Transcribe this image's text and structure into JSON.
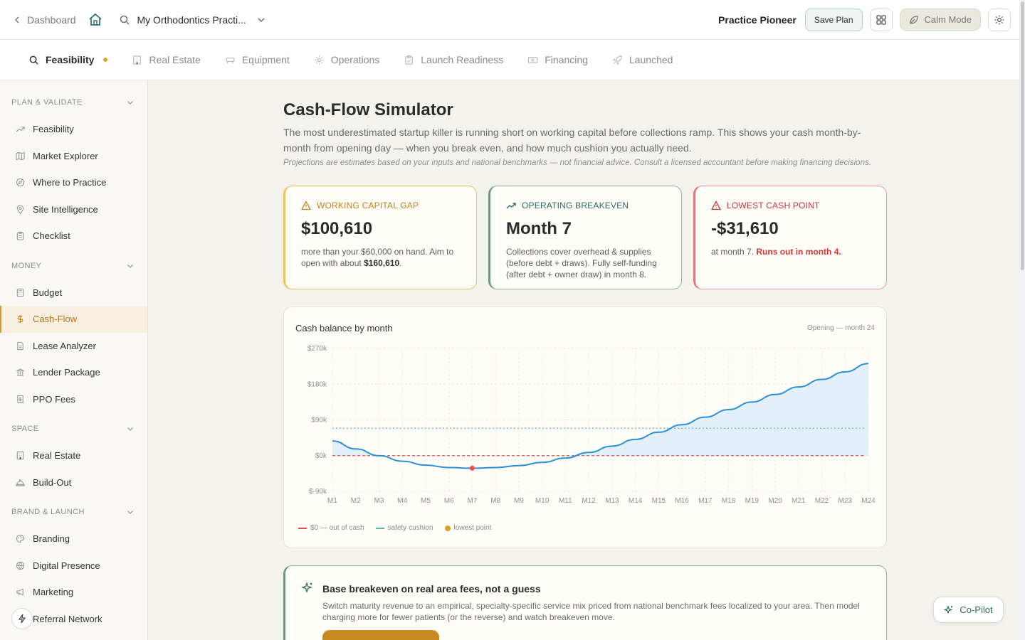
{
  "topbar": {
    "back_label": "Dashboard",
    "practice_name": "My Orthodontics Practi...",
    "brand": "Practice Pioneer",
    "save_label": "Save Plan",
    "calm_label": "Calm Mode"
  },
  "tabs": [
    {
      "label": "Feasibility",
      "icon": "search-icon",
      "active": true
    },
    {
      "label": "Real Estate",
      "icon": "building-icon"
    },
    {
      "label": "Equipment",
      "icon": "chair-icon"
    },
    {
      "label": "Operations",
      "icon": "gear-icon"
    },
    {
      "label": "Launch Readiness",
      "icon": "clipboard-icon"
    },
    {
      "label": "Financing",
      "icon": "card-icon"
    },
    {
      "label": "Launched",
      "icon": "rocket-icon"
    }
  ],
  "sidebar": {
    "sections": [
      {
        "title": "PLAN & VALIDATE",
        "items": [
          "Feasibility",
          "Market Explorer",
          "Where to Practice",
          "Site Intelligence",
          "Checklist"
        ]
      },
      {
        "title": "MONEY",
        "items": [
          "Budget",
          "Cash-Flow",
          "Lease Analyzer",
          "Lender Package",
          "PPO Fees"
        ]
      },
      {
        "title": "SPACE",
        "items": [
          "Real Estate",
          "Build-Out"
        ]
      },
      {
        "title": "BRAND & LAUNCH",
        "items": [
          "Branding",
          "Digital Presence",
          "Marketing",
          "Referral Network"
        ]
      }
    ],
    "active_item": "Cash-Flow"
  },
  "page": {
    "title": "Cash-Flow Simulator",
    "description": "The most underestimated startup killer is running short on working capital before collections ramp. This shows your cash month-by-month from opening day — when you break even, and how much cushion you actually need.",
    "disclaimer": "Projections are estimates based on your inputs and national benchmarks — not financial advice. Consult a licensed accountant before making financing decisions."
  },
  "cards": {
    "gap": {
      "label": "WORKING CAPITAL GAP",
      "value": "$100,610",
      "sub_pre": "more than your $60,000 on hand. Aim to open with about ",
      "sub_bold": "$160,610",
      "sub_post": "."
    },
    "breakeven": {
      "label": "OPERATING BREAKEVEN",
      "value": "Month 7",
      "sub": "Collections cover overhead & supplies (before debt + draws). Fully self-funding (after debt + owner draw) in month 8."
    },
    "lowest": {
      "label": "LOWEST CASH POINT",
      "value": "-$31,610",
      "sub_pre": "at month 7. ",
      "sub_red": "Runs out in month 4."
    }
  },
  "chart": {
    "title": "Cash balance by month",
    "range_label": "Opening — month 24",
    "legend": {
      "zero": "$0 — out of cash",
      "cushion": "safety cushion",
      "lowest": "lowest point"
    },
    "colors": {
      "line": "#2a8fd9",
      "fill": "#d9ebfa",
      "zero": "#e05252",
      "cushion": "#5fb89a",
      "lowest": "#e0a12b",
      "lowest_marker": "#e05252"
    }
  },
  "chart_data": {
    "type": "area",
    "title": "Cash balance by month",
    "x": [
      "M1",
      "M2",
      "M3",
      "M4",
      "M5",
      "M6",
      "M7",
      "M8",
      "M9",
      "M10",
      "M11",
      "M12",
      "M13",
      "M14",
      "M15",
      "M16",
      "M17",
      "M18",
      "M19",
      "M20",
      "M21",
      "M22",
      "M23",
      "M24"
    ],
    "series": [
      {
        "values": [
          37000,
          17000,
          0,
          -14000,
          -24000,
          -30000,
          -31610,
          -30000,
          -25000,
          -17000,
          -6000,
          8000,
          24000,
          41000,
          59000,
          78000,
          97000,
          116000,
          135000,
          154000,
          173000,
          192000,
          211000,
          232000
        ]
      }
    ],
    "yticks": [
      "$270k",
      "$180k",
      "$90k",
      "$0k",
      "$-90k"
    ],
    "ylim": [
      -90000,
      270000
    ],
    "zero_line": 0,
    "safety_cushion": 69000,
    "lowest_point": {
      "month": "M7",
      "value": -31610
    },
    "grid": true,
    "legend_position": "bottom-left"
  },
  "recommendation": {
    "title": "Base breakeven on real area fees, not a guess",
    "description": "Switch maturity revenue to an empirical, specialty-specific service mix priced from national benchmark fees localized to your area. Then model charging more for fewer patients (or the reverse) and watch breakeven move."
  },
  "copilot_label": "Co-Pilot"
}
